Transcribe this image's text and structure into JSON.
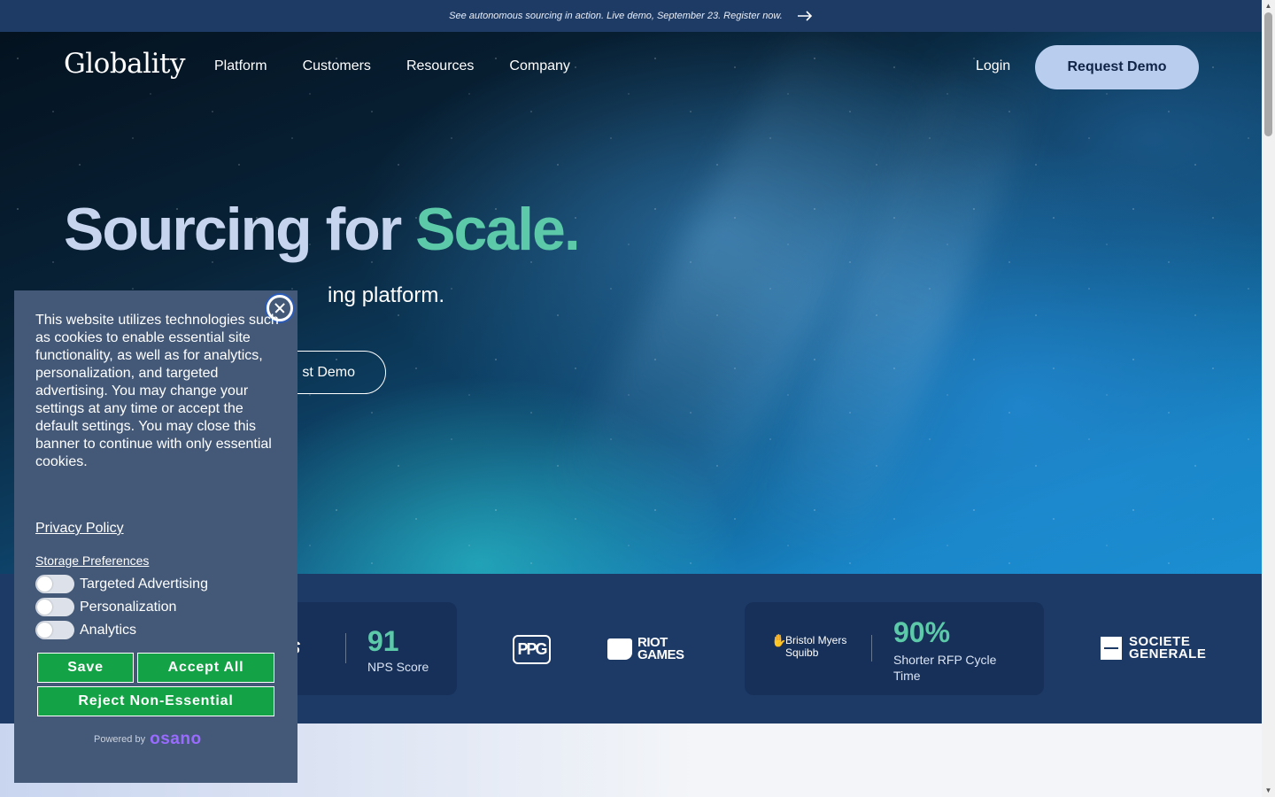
{
  "announcement": {
    "text": "See autonomous sourcing in action. Live demo, September 23. Register now."
  },
  "nav": {
    "logo": "Globality",
    "links": [
      "Platform",
      "Customers",
      "Resources",
      "Company"
    ],
    "login": "Login",
    "cta": "Request Demo"
  },
  "hero": {
    "headline_main": "Sourcing for ",
    "headline_accent": "Scale.",
    "subline": "ing platform.",
    "cta_partial": "st Demo"
  },
  "logos": {
    "elanco_partial": "etis",
    "stat1": {
      "value": "91",
      "label": "NPS Score"
    },
    "ppg": "PPG",
    "riot": [
      "RIOT",
      "GAMES"
    ],
    "bms": [
      "Bristol Myers",
      "Squibb"
    ],
    "stat2": {
      "value": "90%",
      "label": "Shorter RFP Cycle Time"
    },
    "socgen": [
      "SOCIETE",
      "GENERALE"
    ]
  },
  "cookie": {
    "text": "This website utilizes technologies such as cookies to enable essential site functionality, as well as for analytics, personalization, and targeted advertising. You may change your settings at any time or accept the default settings. You may close this banner to continue with only essential cookies.",
    "privacy_link": "Privacy Policy",
    "storage_link": "Storage Preferences",
    "toggles": [
      "Targeted Advertising",
      "Personalization",
      "Analytics"
    ],
    "save": "Save",
    "accept_all": "Accept All",
    "reject": "Reject Non-Essential",
    "powered_by": "Powered by",
    "osano": "osano"
  },
  "colors": {
    "accent_green": "#5ccaa8",
    "navy": "#1d3a66",
    "button_green": "#13a246",
    "banner_bg": "#445978"
  }
}
